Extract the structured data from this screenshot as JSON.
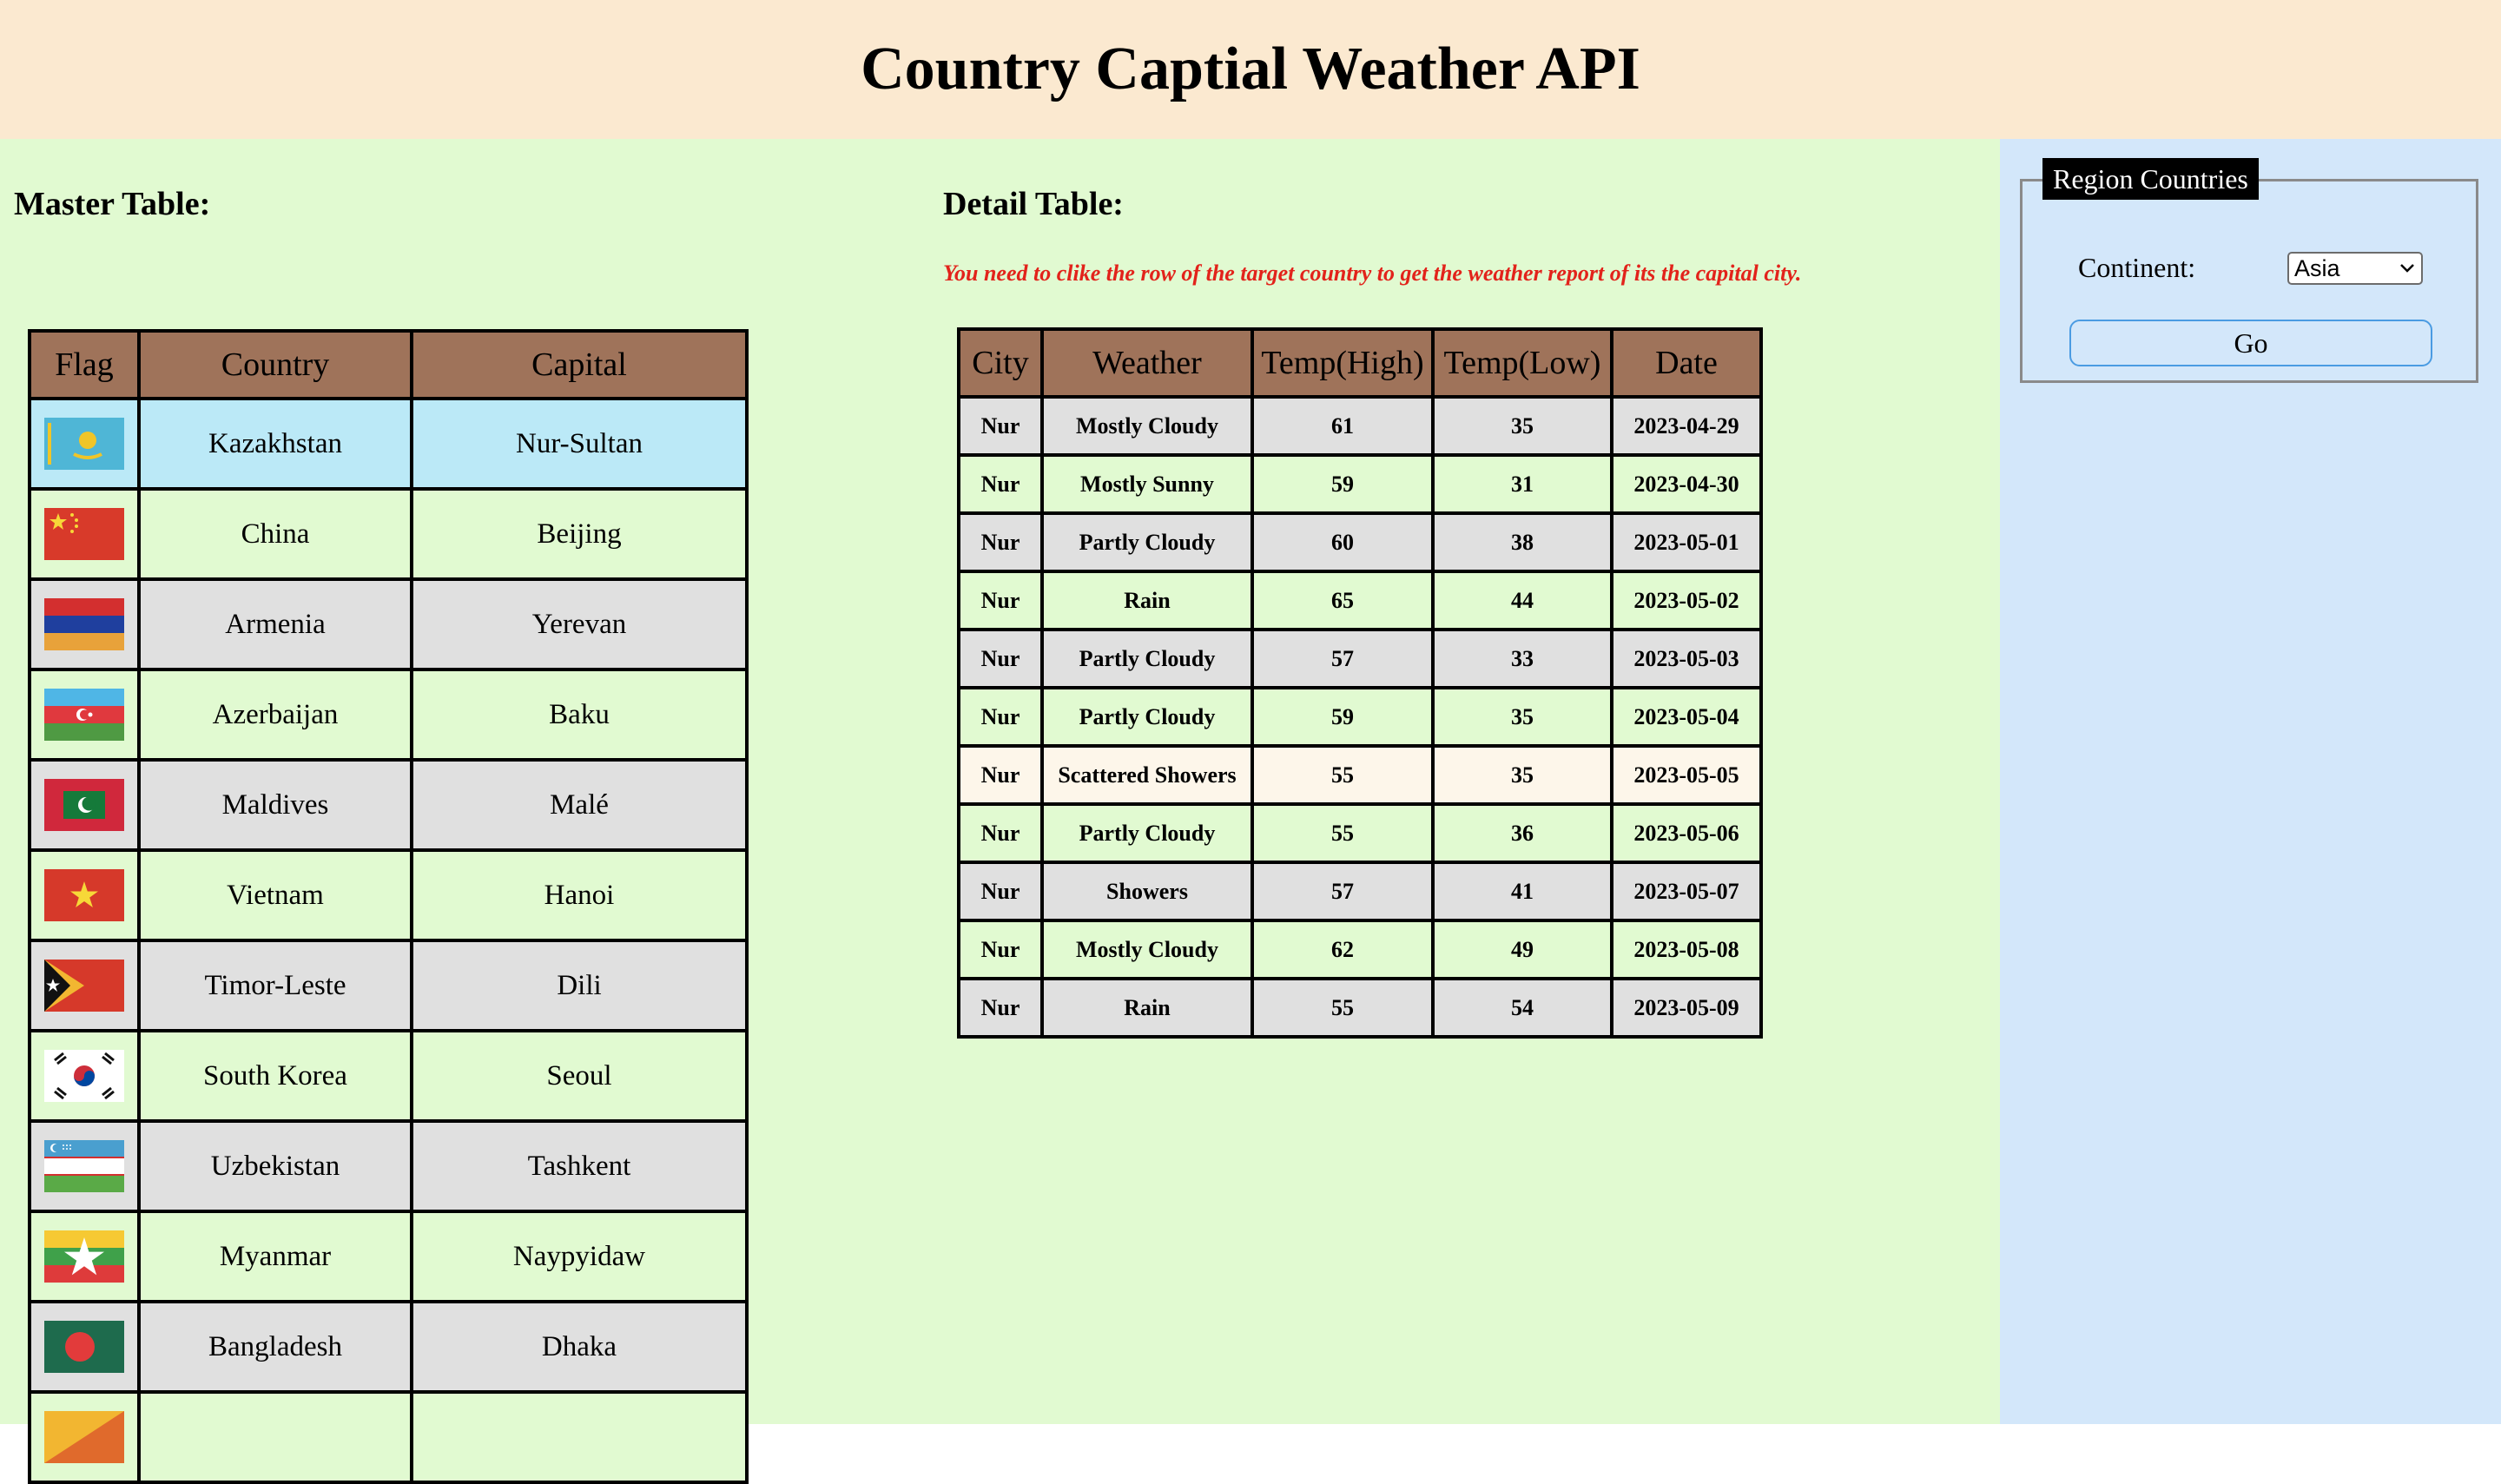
{
  "title": "Country Captial Weather API",
  "master": {
    "title": "Master Table:",
    "headers": [
      "Flag",
      "Country",
      "Capital"
    ],
    "rows": [
      {
        "flag": "kazakhstan-flag",
        "country": "Kazakhstan",
        "capital": "Nur-Sultan"
      },
      {
        "flag": "china-flag",
        "country": "China",
        "capital": "Beijing"
      },
      {
        "flag": "armenia-flag",
        "country": "Armenia",
        "capital": "Yerevan"
      },
      {
        "flag": "azerbaijan-flag",
        "country": "Azerbaijan",
        "capital": "Baku"
      },
      {
        "flag": "maldives-flag",
        "country": "Maldives",
        "capital": "Malé"
      },
      {
        "flag": "vietnam-flag",
        "country": "Vietnam",
        "capital": "Hanoi"
      },
      {
        "flag": "timor-leste-flag",
        "country": "Timor-Leste",
        "capital": "Dili"
      },
      {
        "flag": "south-korea-flag",
        "country": "South Korea",
        "capital": "Seoul"
      },
      {
        "flag": "uzbekistan-flag",
        "country": "Uzbekistan",
        "capital": "Tashkent"
      },
      {
        "flag": "myanmar-flag",
        "country": "Myanmar",
        "capital": "Naypyidaw"
      },
      {
        "flag": "bangladesh-flag",
        "country": "Bangladesh",
        "capital": "Dhaka"
      },
      {
        "flag": "bhutan-flag",
        "country": "",
        "capital": ""
      }
    ]
  },
  "detail": {
    "title": "Detail Table:",
    "hint": "You need to clike the row of the target country to get the weather report of its the capital city.",
    "headers": [
      "City",
      "Weather",
      "Temp(High)",
      "Temp(Low)",
      "Date"
    ],
    "rows": [
      {
        "city": "Nur",
        "weather": "Mostly Cloudy",
        "high": "61",
        "low": "35",
        "date": "2023-04-29"
      },
      {
        "city": "Nur",
        "weather": "Mostly Sunny",
        "high": "59",
        "low": "31",
        "date": "2023-04-30"
      },
      {
        "city": "Nur",
        "weather": "Partly Cloudy",
        "high": "60",
        "low": "38",
        "date": "2023-05-01"
      },
      {
        "city": "Nur",
        "weather": "Rain",
        "high": "65",
        "low": "44",
        "date": "2023-05-02"
      },
      {
        "city": "Nur",
        "weather": "Partly Cloudy",
        "high": "57",
        "low": "33",
        "date": "2023-05-03"
      },
      {
        "city": "Nur",
        "weather": "Partly Cloudy",
        "high": "59",
        "low": "35",
        "date": "2023-05-04"
      },
      {
        "city": "Nur",
        "weather": "Scattered Showers",
        "high": "55",
        "low": "35",
        "date": "2023-05-05"
      },
      {
        "city": "Nur",
        "weather": "Partly Cloudy",
        "high": "55",
        "low": "36",
        "date": "2023-05-06"
      },
      {
        "city": "Nur",
        "weather": "Showers",
        "high": "57",
        "low": "41",
        "date": "2023-05-07"
      },
      {
        "city": "Nur",
        "weather": "Mostly Cloudy",
        "high": "62",
        "low": "49",
        "date": "2023-05-08"
      },
      {
        "city": "Nur",
        "weather": "Rain",
        "high": "55",
        "low": "54",
        "date": "2023-05-09"
      }
    ]
  },
  "side": {
    "legend": "Region Countries",
    "continent_label": "Continent:",
    "continent_value": "Asia",
    "select_icon": "chevron-down-icon",
    "go_label": "Go"
  },
  "colors": {
    "header_bg": "#fbe9d0",
    "main_bg": "#e1fad1",
    "side_bg": "#d3e7fa",
    "table_header_bg": "#9f735a",
    "selected_row_bg": "#bbe9f7",
    "hint_text": "#e2231b"
  }
}
